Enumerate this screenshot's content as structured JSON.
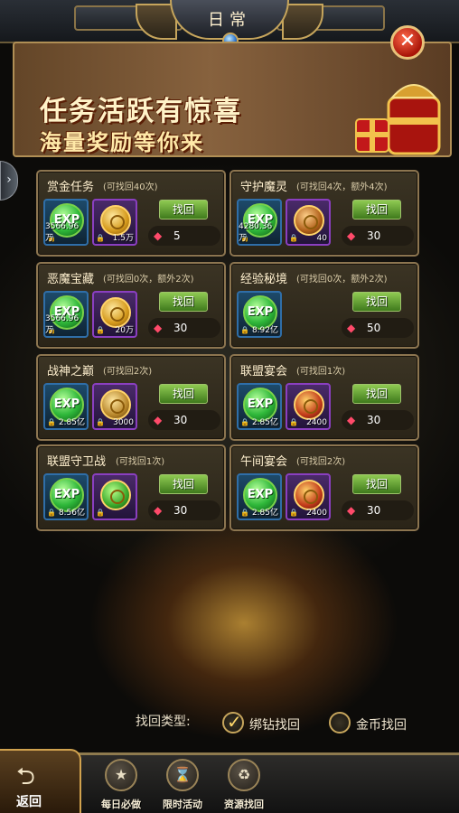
{
  "header": {
    "title": "日常"
  },
  "banner": {
    "line1": "任务活跃有惊喜",
    "line2": "海量奖励等你来"
  },
  "cards": [
    {
      "title": "赏金任务",
      "sub": "(可找回40次)",
      "items": [
        {
          "type": "exp",
          "amount": "3566.96万"
        },
        {
          "type": "coin",
          "amount": "1.5万"
        }
      ],
      "button": "找回",
      "cost": "5"
    },
    {
      "title": "守护魔灵",
      "sub": "(可找回4次，额外4次)",
      "items": [
        {
          "type": "exp",
          "amount": "4280.36万"
        },
        {
          "type": "lamp",
          "amount": "40"
        }
      ],
      "button": "找回",
      "cost": "30"
    },
    {
      "title": "恶魔宝藏",
      "sub": "(可找回0次，额外2次)",
      "items": [
        {
          "type": "exp",
          "amount": "3566.96万"
        },
        {
          "type": "coin",
          "amount": "20万"
        }
      ],
      "button": "找回",
      "cost": "30"
    },
    {
      "title": "经验秘境",
      "sub": "(可找回0次，额外2次)",
      "items": [
        {
          "type": "exp",
          "amount": "8.92亿"
        }
      ],
      "button": "找回",
      "cost": "50"
    },
    {
      "title": "战神之巅",
      "sub": "(可找回2次)",
      "items": [
        {
          "type": "exp",
          "amount": "2.85亿"
        },
        {
          "type": "shield",
          "amount": "3000"
        }
      ],
      "button": "找回",
      "cost": "30"
    },
    {
      "title": "联盟宴会",
      "sub": "(可找回1次)",
      "items": [
        {
          "type": "exp",
          "amount": "2.85亿"
        },
        {
          "type": "trophy",
          "amount": "2400"
        }
      ],
      "button": "找回",
      "cost": "30"
    },
    {
      "title": "联盟守卫战",
      "sub": "(可找回1次)",
      "items": [
        {
          "type": "exp",
          "amount": "8.56亿"
        },
        {
          "type": "slime",
          "amount": ""
        }
      ],
      "button": "找回",
      "cost": "30"
    },
    {
      "title": "午间宴会",
      "sub": "(可找回2次)",
      "items": [
        {
          "type": "exp",
          "amount": "2.85亿"
        },
        {
          "type": "trophy",
          "amount": "2400"
        }
      ],
      "button": "找回",
      "cost": "30"
    }
  ],
  "exp_label": "EXP",
  "retrieve": {
    "type_label": "找回类型:",
    "option1": "绑钻找回",
    "option2": "金币找回"
  },
  "nav": {
    "back": "返回",
    "daily": "每日必做",
    "limited": "限时活动",
    "retrieve": "资源找回"
  }
}
